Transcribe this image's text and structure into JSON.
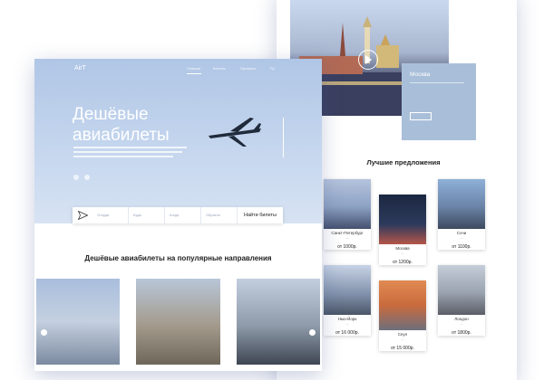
{
  "back_page": {
    "banner_city": "Москва",
    "best_title": "Лучшие предложения",
    "deals": [
      {
        "city": "Санкт-Петербург",
        "price": "от 1000р."
      },
      {
        "city": "Москва",
        "price": "от 1200р."
      },
      {
        "city": "Сочи",
        "price": "от 1100р."
      },
      {
        "city": "Нью-Йорк",
        "price": "от 16 000р."
      },
      {
        "city": "Сеул",
        "price": "от 15 000р."
      },
      {
        "city": "Лондон",
        "price": "от 1800р."
      }
    ]
  },
  "front_page": {
    "logo": "AirT",
    "nav": [
      "Главная",
      "Билеты",
      "Профиль",
      "Ру"
    ],
    "headline": "Дешёвые авиабилеты",
    "search_fields": [
      "Откуда",
      "Куда",
      "Когда",
      "Обратно"
    ],
    "search_button": "Найти билеты",
    "popular_title": "Дешёвые авиабилеты на популярные направления"
  },
  "colors": {
    "hero_blue": "#b0c6e6",
    "card_blue": "#a9bfd9",
    "text_dark": "#222222"
  }
}
